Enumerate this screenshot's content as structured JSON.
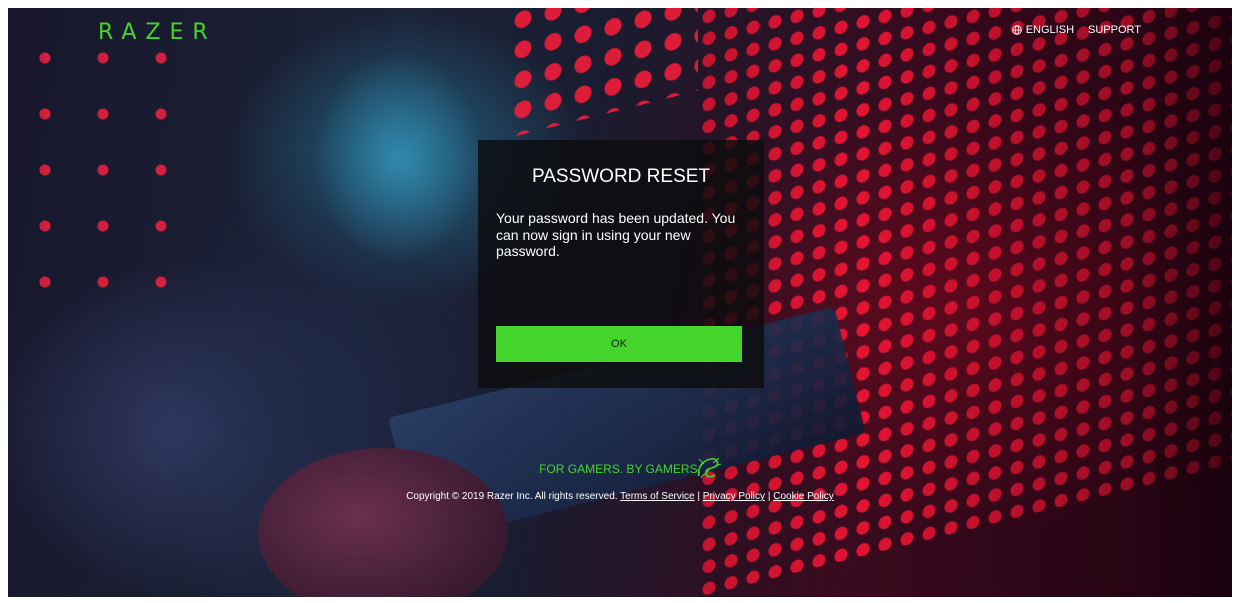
{
  "header": {
    "logo_text": "RAZER",
    "language_label": "ENGLISH",
    "support_label": "SUPPORT"
  },
  "modal": {
    "title": "PASSWORD RESET",
    "message": "Your password has been updated. You can now sign in using your new password.",
    "ok_label": "OK"
  },
  "footer": {
    "tagline": "FOR GAMERS. BY GAMERS.",
    "copyright": "Copyright © 2019 Razer Inc. All rights reserved.",
    "terms_label": "Terms of Service",
    "separator": "|",
    "privacy_label": "Privacy Policy",
    "cookie_label": "Cookie Policy"
  },
  "icons": {
    "language": "globe-icon",
    "brand_mark": "razer-snake-icon"
  },
  "colors": {
    "brand_green": "#44d62c",
    "modal_bg": "#0c0c0e",
    "accent_red": "#ff1636"
  }
}
